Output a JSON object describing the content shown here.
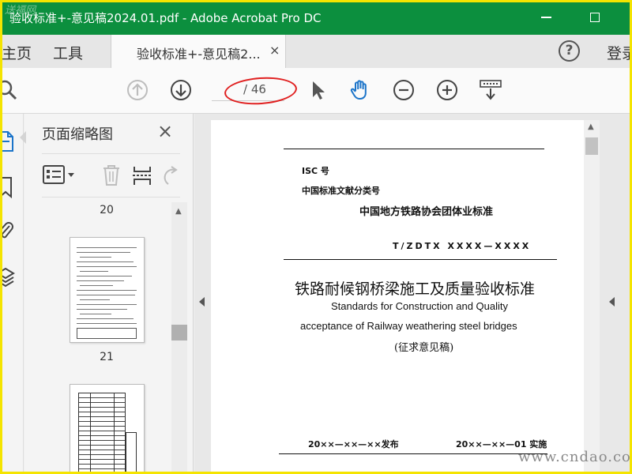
{
  "window": {
    "title": "验收标准+-意见稿2024.01.pdf - Adobe Acrobat Pro DC",
    "watermark": "送福网",
    "theme_color": "#0c8f3e"
  },
  "tabs": {
    "home": "主页",
    "tools": "工具",
    "document": "验收标准+-意见稿2...",
    "close": "×",
    "help": "?",
    "login": "登录"
  },
  "toolbar": {
    "current_page": "",
    "total_pages": "/ 46",
    "icons": [
      "search-icon",
      "prev-page-icon",
      "next-page-icon",
      "select-cursor-icon",
      "hand-tool-icon",
      "zoom-out-icon",
      "zoom-in-icon",
      "scroll-mode-icon"
    ]
  },
  "thumbnails": {
    "heading": "页面缩略图",
    "close": "×",
    "pages": [
      "20",
      "21"
    ]
  },
  "document": {
    "isc": "ISC 号",
    "category": "中国标准文献分类号",
    "association": "中国地方铁路协会团体业标准",
    "code": "T/ZDTX  XXXX—XXXX",
    "title_cn": "铁路耐候钢桥梁施工及质量验收标准",
    "title_en_1": "Standards for Construction and Quality",
    "title_en_2": "acceptance of Railway weathering steel bridges",
    "status": "(征求意见稿)",
    "publish": "20××—××—××发布",
    "implement": "20××—××—01 实施"
  },
  "site_watermark": "www.cndao.com"
}
